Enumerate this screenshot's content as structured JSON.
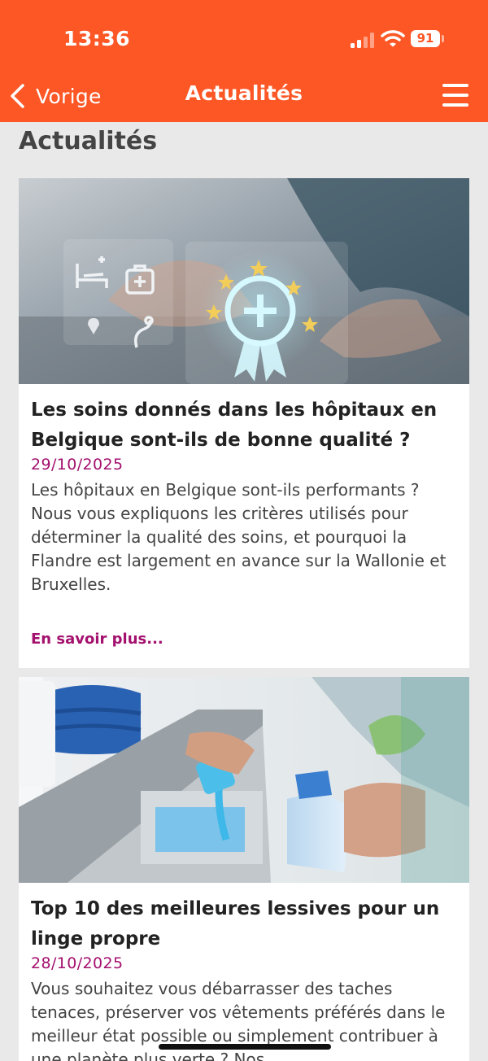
{
  "status_bar": {
    "time": "13:36",
    "battery": "91"
  },
  "navbar": {
    "back_label": "Vorige",
    "title": "Actualités"
  },
  "page": {
    "heading": "Actualités"
  },
  "articles": [
    {
      "title": "Les soins donnés dans les hôpitaux en Belgique sont-ils de bonne qualité ?",
      "date": "29/10/2025",
      "excerpt": "Les hôpitaux en Belgique sont-ils performants ? Nous vous expliquons les critères utilisés pour déterminer la qualité des soins, et pourquoi la Flandre est largement en avance sur la Wallonie et Bruxelles.",
      "read_more": "En savoir plus..."
    },
    {
      "title": "Top 10 des meilleures lessives pour un linge propre",
      "date": "28/10/2025",
      "excerpt": "Vous souhaitez vous débarrasser des taches tenaces, préserver vos vêtements préférés dans le meilleur état possible ou simplement contribuer à une planète plus verte ? Nos"
    }
  ],
  "colors": {
    "header": "#fd5726",
    "accent": "#a3106e",
    "background": "#e9e9e9",
    "card": "#ffffff"
  },
  "icons": {
    "back": "chevron-left-icon",
    "menu": "hamburger-menu-icon",
    "signal": "cellular-signal-icon",
    "wifi": "wifi-icon",
    "battery": "battery-icon"
  }
}
